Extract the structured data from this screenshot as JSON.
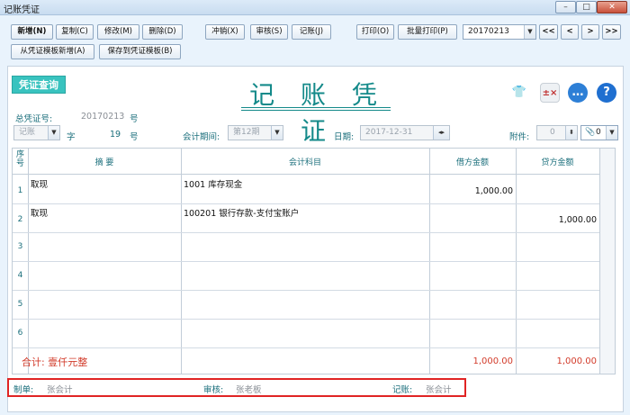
{
  "window": {
    "title": "记账凭证",
    "min": "–",
    "max": "□",
    "close": "✕"
  },
  "toolbar": {
    "new": "新增(N)",
    "copy": "复制(C)",
    "edit": "修改(M)",
    "delete": "删除(D)",
    "reverse": "冲销(X)",
    "audit": "审核(S)",
    "post": "记账(J)",
    "print": "打印(O)",
    "batch_print": "批量打印(P)",
    "new_from_template": "从凭证模板新增(A)",
    "save_as_template": "保存到凭证模板(B)",
    "voucher_no": "20170213",
    "nav_first": "<<",
    "nav_prev": "<",
    "nav_next": ">",
    "nav_last": ">>"
  },
  "header": {
    "query_button": "凭证查询",
    "title": "记 账 凭 证",
    "total_no_label": "总凭证号:",
    "total_no_value": "20170213",
    "total_no_unit": "号",
    "voucher_type": "记账",
    "zi": "字",
    "voucher_number": "19",
    "hao": "号",
    "period_label": "会计期间:",
    "period_value": "第12期",
    "date_label": "日期:",
    "date_value": "2017-12-31",
    "attach_label": "附件:",
    "attach_value": "0",
    "attach_count": "0"
  },
  "icons": {
    "shirt": "shirt-icon",
    "calc": "calculator-icon",
    "chat": "chat-icon",
    "help": "help-icon"
  },
  "table": {
    "headers": {
      "seq": "序号",
      "summary": "摘 要",
      "account": "会计科目",
      "debit": "借方金额",
      "credit": "贷方金额"
    },
    "rows": [
      {
        "seq": "1",
        "summary": "取现",
        "account": "1001 库存现金",
        "debit": "1,000.00",
        "credit": ""
      },
      {
        "seq": "2",
        "summary": "取现",
        "account": "100201 银行存款-支付宝账户",
        "debit": "",
        "credit": "1,000.00"
      },
      {
        "seq": "3",
        "summary": "",
        "account": "",
        "debit": "",
        "credit": ""
      },
      {
        "seq": "4",
        "summary": "",
        "account": "",
        "debit": "",
        "credit": ""
      },
      {
        "seq": "5",
        "summary": "",
        "account": "",
        "debit": "",
        "credit": ""
      },
      {
        "seq": "6",
        "summary": "",
        "account": "",
        "debit": "",
        "credit": ""
      }
    ],
    "total_label": "合计: 壹仟元整",
    "total_debit": "1,000.00",
    "total_credit": "1,000.00"
  },
  "footer": {
    "maker_label": "制单:",
    "maker_value": "张会计",
    "auditor_label": "审核:",
    "auditor_value": "张老板",
    "poster_label": "记账:",
    "poster_value": "张会计"
  },
  "colors": {
    "accent": "#148a8a",
    "highlight": "#e02424",
    "total": "#d23b2a"
  }
}
